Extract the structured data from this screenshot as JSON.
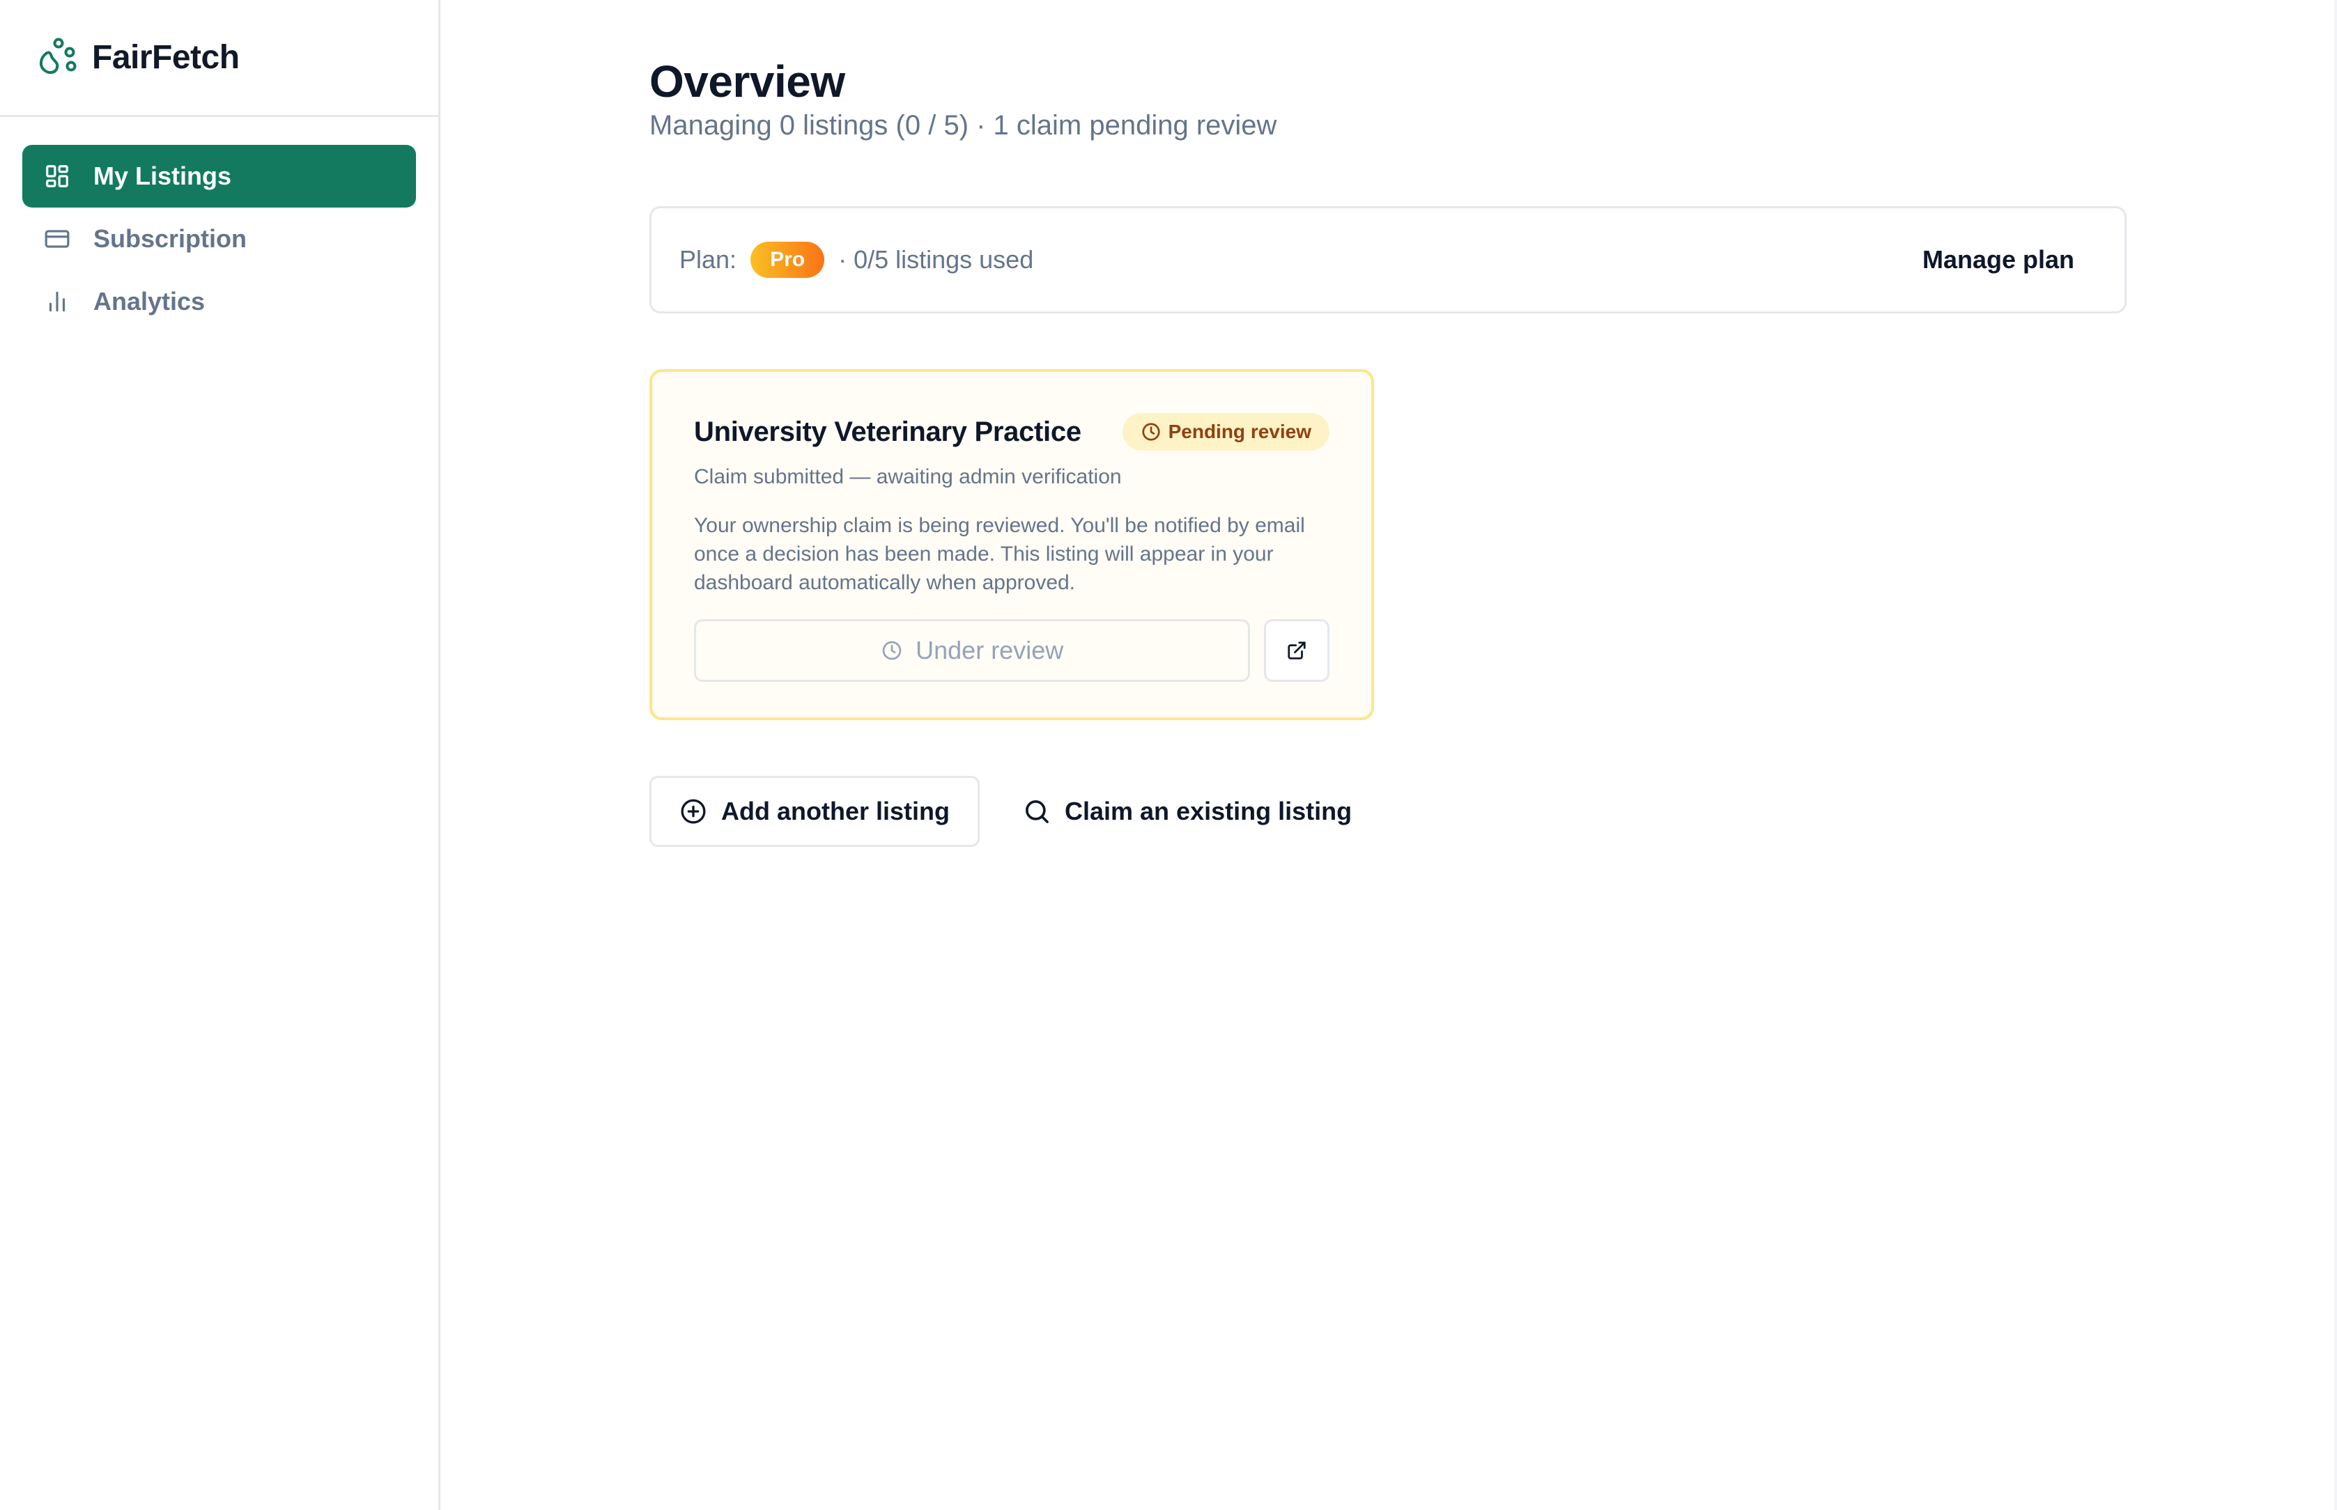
{
  "app": {
    "name": "FairFetch"
  },
  "sidebar": {
    "items": [
      {
        "label": "My Listings",
        "icon": "grid-icon",
        "active": true
      },
      {
        "label": "Subscription",
        "icon": "credit-card-icon",
        "active": false
      },
      {
        "label": "Analytics",
        "icon": "bar-chart-icon",
        "active": false
      }
    ]
  },
  "main": {
    "title": "Overview",
    "subtitle": "Managing 0 listings (0 / 5) · 1 claim pending review",
    "plan": {
      "label": "Plan:",
      "tier": "Pro",
      "usage": "· 0/5 listings used",
      "manage_label": "Manage plan"
    },
    "claim_card": {
      "title": "University Veterinary Practice",
      "badge": "Pending review",
      "status": "Claim submitted — awaiting admin verification",
      "description": "Your ownership claim is being reviewed. You'll be notified by email once a decision has been made. This listing will appear in your dashboard automatically when approved.",
      "review_button": "Under review"
    },
    "actions": {
      "add_listing": "Add another listing",
      "claim_listing": "Claim an existing listing"
    }
  },
  "colors": {
    "brand": "#137a5f",
    "pending_bg": "#fef3c7",
    "pending_text": "#92400e",
    "pro_badge_start": "#fbbf24",
    "pro_badge_end": "#f97316",
    "muted_text": "#64748b"
  }
}
